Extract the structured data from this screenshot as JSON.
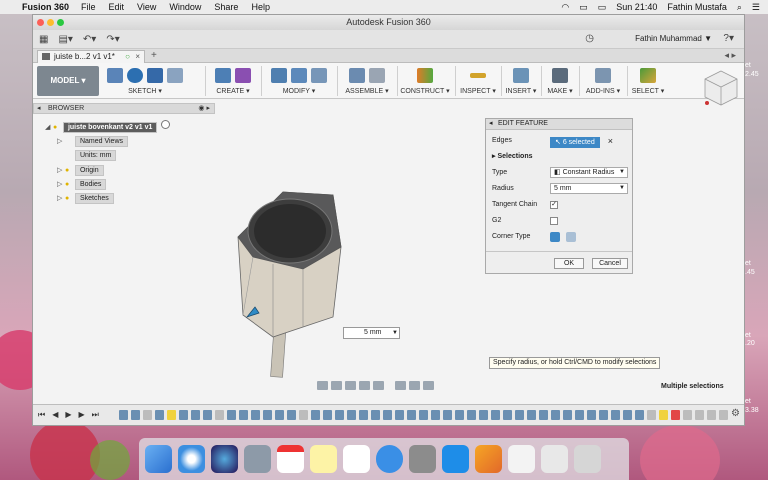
{
  "menubar": {
    "app_name": "Fusion 360",
    "items": [
      "File",
      "Edit",
      "View",
      "Window",
      "Share",
      "Help"
    ],
    "clock": "Sun 21:40",
    "user": "Fathin Mustafa"
  },
  "window": {
    "title": "Autodesk Fusion 360",
    "account": "Fathin Muhammad ▼",
    "tab_label": "juiste b...2 v1 v1*"
  },
  "toolbar": {
    "model_label": "MODEL ▾",
    "groups": [
      "SKETCH ▾",
      "CREATE ▾",
      "MODIFY ▾",
      "ASSEMBLE ▾",
      "CONSTRUCT ▾",
      "INSPECT ▾",
      "INSERT ▾",
      "MAKE ▾",
      "ADD-INS ▾",
      "SELECT ▾"
    ]
  },
  "browser": {
    "header": "BROWSER",
    "root": "juiste bovenkant v2 v1 v1",
    "nodes": [
      "Named Views",
      "Units: mm",
      "Origin",
      "Bodies",
      "Sketches"
    ]
  },
  "dialog": {
    "title": "EDIT FEATURE",
    "edges_label": "Edges",
    "edges_value": "6 selected",
    "selections_label": "Selections",
    "type_label": "Type",
    "type_value": "Constant Radius",
    "radius_label": "Radius",
    "radius_value": "5 mm",
    "tangent_label": "Tangent Chain",
    "g2_label": "G2",
    "corner_label": "Corner Type",
    "ok": "OK",
    "cancel": "Cancel"
  },
  "canvas": {
    "radius_input": "5 mm",
    "tooltip": "Specify radius, or hold Ctrl/CMD to modify selections",
    "status": "Multiple selections"
  },
  "right_edge": {
    "t1": "et",
    "t2": "2.45",
    "t3": "et",
    "t4": ".45",
    "t5": "et",
    "t6": ".20",
    "t7": "et",
    "t8": "3.38"
  },
  "colors": {
    "selection_blue": "#3d88c6",
    "model_body": "#d8d1c4",
    "model_top": "#4a4a4a"
  }
}
